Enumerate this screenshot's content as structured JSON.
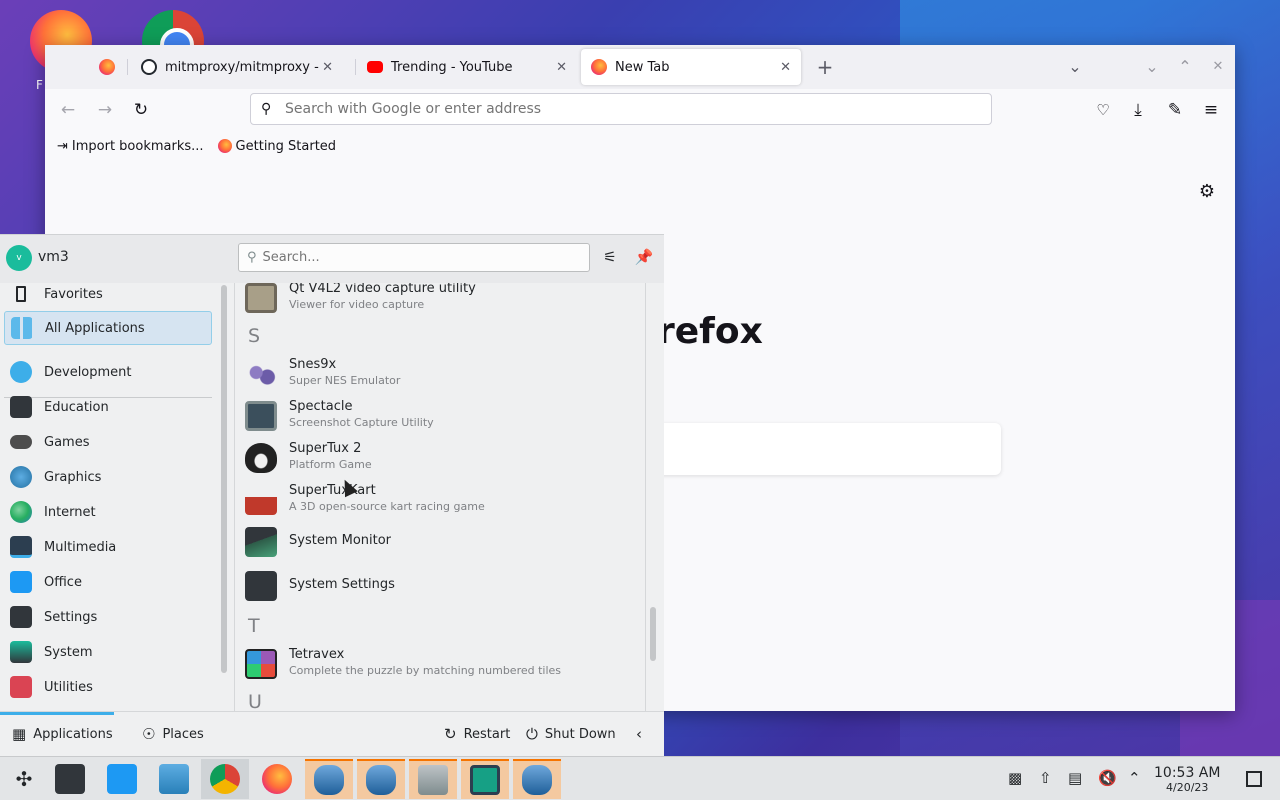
{
  "desktop": {
    "firefox_label": "F"
  },
  "browser": {
    "tabs": [
      {
        "label": "",
        "favicon": "firefox-icon"
      },
      {
        "label": "mitmproxy/mitmproxy - Do",
        "favicon": "github-icon"
      },
      {
        "label": "Trending - YouTube",
        "favicon": "youtube-icon"
      },
      {
        "label": "New Tab",
        "favicon": "firefox-icon"
      }
    ],
    "url_placeholder": "Search with Google or enter address",
    "bookmarks": [
      {
        "label": "Import bookmarks..."
      },
      {
        "label": "Getting Started"
      }
    ],
    "newtab_wordmark": "refox"
  },
  "launcher": {
    "user": {
      "initial": "v",
      "name": "vm3"
    },
    "search_placeholder": "Search...",
    "categories": [
      {
        "label": "Favorites",
        "icon": "bookmark-icon",
        "color": "#232629"
      },
      {
        "label": "All Applications",
        "icon": "grid-icon",
        "color": "#3daee9"
      },
      {
        "label": "Development",
        "icon": "development-icon",
        "color": "#3daee9"
      },
      {
        "label": "Education",
        "icon": "education-icon",
        "color": "#31363b"
      },
      {
        "label": "Games",
        "icon": "gamepad-icon",
        "color": "#4d4d4d"
      },
      {
        "label": "Graphics",
        "icon": "graphics-icon",
        "color": "#2980b9"
      },
      {
        "label": "Internet",
        "icon": "globe-icon",
        "color": "#27ae60"
      },
      {
        "label": "Multimedia",
        "icon": "multimedia-icon",
        "color": "#2c3e50"
      },
      {
        "label": "Office",
        "icon": "office-icon",
        "color": "#1d99f3"
      },
      {
        "label": "Settings",
        "icon": "settings-icon",
        "color": "#31363b"
      },
      {
        "label": "System",
        "icon": "system-icon",
        "color": "#1abc9c"
      },
      {
        "label": "Utilities",
        "icon": "utilities-icon",
        "color": "#da4453"
      }
    ],
    "apps": [
      {
        "name": "Qt V4L2 video capture utility",
        "desc": "Viewer for video capture",
        "icon": "webcam-icon",
        "color": "#a89f88"
      },
      {
        "letter": "S"
      },
      {
        "name": "Snes9x",
        "desc": "Super NES Emulator",
        "icon": "snes-icon",
        "color": "#8e7cc3"
      },
      {
        "name": "Spectacle",
        "desc": "Screenshot Capture Utility",
        "icon": "spectacle-icon",
        "color": "#3b4f5c"
      },
      {
        "name": "SuperTux 2",
        "desc": "Platform Game",
        "icon": "tux-icon",
        "color": "#222222"
      },
      {
        "name": "SuperTuxKart",
        "desc": "A 3D open-source kart racing game",
        "icon": "kart-icon",
        "color": "#c0392b"
      },
      {
        "name": "System Monitor",
        "desc": "",
        "icon": "system-monitor-icon",
        "color": "#2d5b48"
      },
      {
        "name": "System Settings",
        "desc": "",
        "icon": "system-settings-icon",
        "color": "#31363b"
      },
      {
        "letter": "T"
      },
      {
        "name": "Tetravex",
        "desc": "Complete the puzzle by matching numbered tiles",
        "icon": "tetravex-icon",
        "color": "#9b59b6"
      },
      {
        "letter": "U"
      }
    ],
    "footer": {
      "applications": "Applications",
      "places": "Places",
      "restart": "Restart",
      "shutdown": "Shut Down"
    }
  },
  "taskbar": {
    "clock_time": "10:53 AM",
    "clock_date": "4/20/23"
  }
}
